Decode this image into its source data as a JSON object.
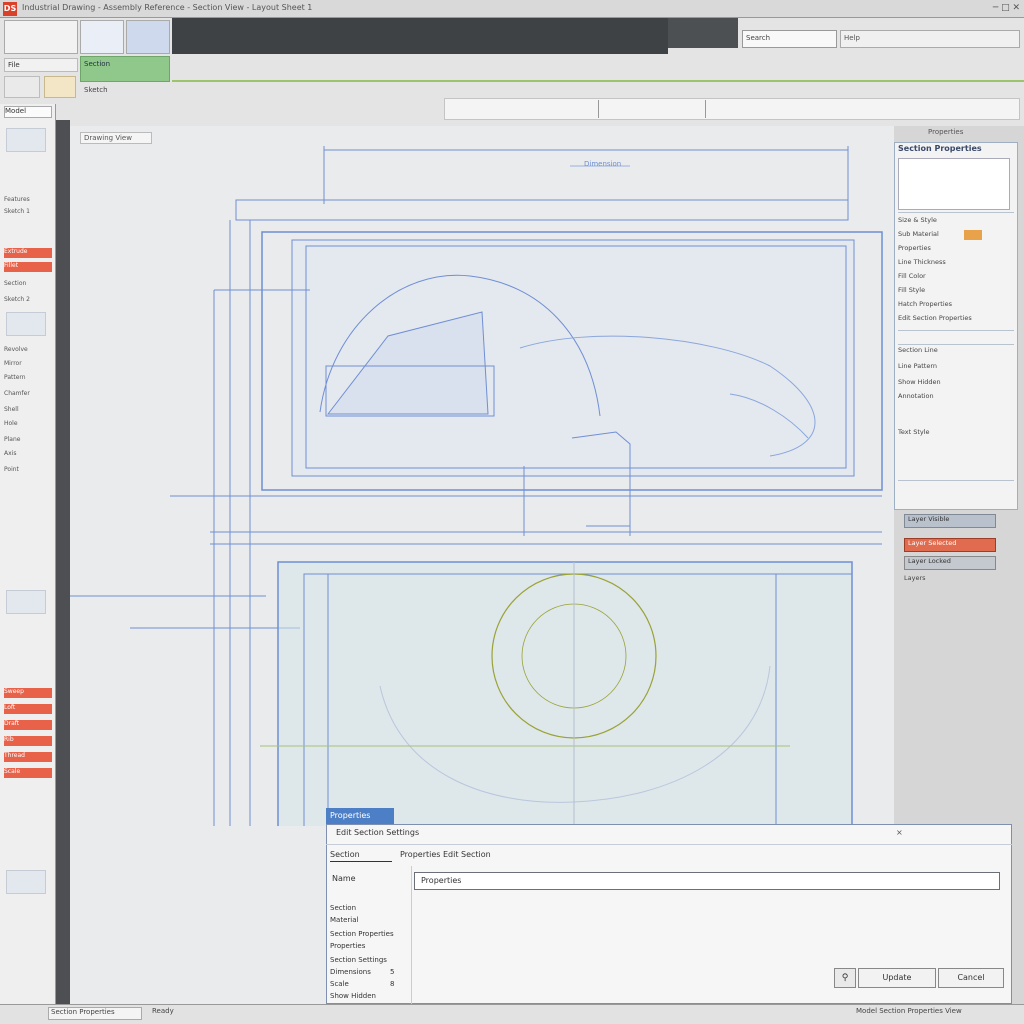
{
  "titlebar": {
    "app_logo": "DS",
    "title": "Industrial Drawing - Assembly Reference - Section View - Layout Sheet 1",
    "controls": "─ □ ✕"
  },
  "ribbon": {
    "file_tab": "File",
    "green_tab": "Section",
    "small_text": "Sketch",
    "search_placeholder": "Search",
    "search2_value": "Help"
  },
  "left_panel": {
    "header": "Model",
    "items": [
      {
        "label": "Features",
        "red": false
      },
      {
        "label": "Sketch 1",
        "red": false
      },
      {
        "label": "Extrude",
        "red": true
      },
      {
        "label": "Fillet",
        "red": true
      },
      {
        "label": "Section",
        "red": false
      },
      {
        "label": "Sketch 2",
        "red": false
      },
      {
        "label": "Revolve",
        "red": false
      },
      {
        "label": "Mirror",
        "red": false
      },
      {
        "label": "Pattern",
        "red": false
      },
      {
        "label": "Chamfer",
        "red": false
      },
      {
        "label": "Shell",
        "red": false
      },
      {
        "label": "Hole",
        "red": false
      },
      {
        "label": "Plane",
        "red": false
      },
      {
        "label": "Axis",
        "red": false
      },
      {
        "label": "Point",
        "red": false
      },
      {
        "label": "Sweep",
        "red": true
      },
      {
        "label": "Loft",
        "red": true
      },
      {
        "label": "Draft",
        "red": true
      },
      {
        "label": "Rib",
        "red": true
      },
      {
        "label": "Thread",
        "red": true
      },
      {
        "label": "Scale",
        "red": true
      }
    ]
  },
  "canvas": {
    "label": "Drawing View",
    "dim_label": "Dimension"
  },
  "properties": {
    "tab": "Properties",
    "header": "Section Properties",
    "lines": [
      "Size & Style",
      "Sub Material",
      "Properties",
      "Line Thickness",
      "Fill Color",
      "Fill Style",
      "Hatch Properties",
      "Edit Section Properties",
      "Section Line",
      "Line Pattern",
      "Show Hidden",
      "Annotation",
      "Text Style"
    ],
    "layer_buttons": [
      "Layer Visible",
      "Layer Selected",
      "Layer Locked"
    ],
    "layer_label": "Layers"
  },
  "dialog": {
    "tab": "Properties",
    "title": "Edit Section Settings",
    "close": "×",
    "tab_a": "Section",
    "tab_b": "Properties Edit Section",
    "field_label": "Name",
    "input_value": "Properties",
    "options": [
      {
        "label": "Section",
        "num": ""
      },
      {
        "label": "Material",
        "num": ""
      },
      {
        "label": "Section Properties",
        "num": ""
      },
      {
        "label": "Properties",
        "num": ""
      },
      {
        "label": "Section Settings",
        "num": ""
      },
      {
        "label": "Dimensions",
        "num": "5"
      },
      {
        "label": "Scale",
        "num": "8"
      },
      {
        "label": "Show Hidden",
        "num": ""
      }
    ],
    "icon_btn": "⚲",
    "ok": "Update",
    "cancel": "Cancel"
  },
  "statusbar": {
    "left": "Section Properties",
    "mid": "Ready",
    "right": "Model Section Properties View"
  },
  "colors": {
    "accent_blue": "#4d7fc6",
    "highlight_red": "#e06b4e",
    "ribbon_green": "#8fc88a",
    "drawing_blue": "#6f8fd4",
    "circle_olive": "#9aa236"
  }
}
